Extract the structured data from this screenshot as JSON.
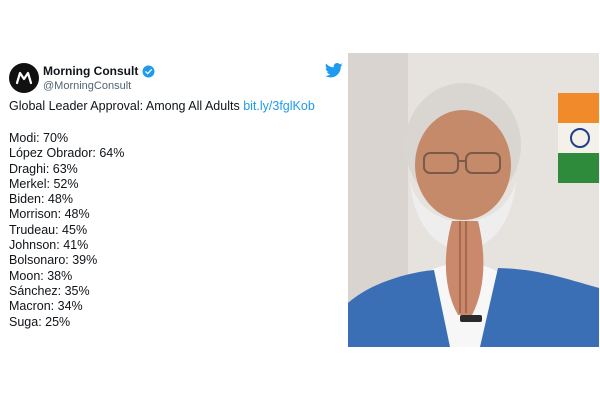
{
  "tweet": {
    "author": "Morning Consult",
    "handle": "@MorningConsult",
    "headline": "Global Leader Approval: Among All Adults",
    "link_text": "bit.ly/3fglKob",
    "list": [
      "Modi: 70%",
      "López Obrador: 64%",
      "Draghi: 63%",
      "Merkel: 52%",
      "Biden: 48%",
      "Morrison: 48%",
      "Trudeau: 45%",
      "Johnson: 41%",
      "Bolsonaro: 39%",
      "Moon: 38%",
      "Sánchez: 35%",
      "Macron: 34%",
      "Suga: 25%"
    ]
  },
  "icons": {
    "avatar": "morning-consult-logo-icon",
    "verified": "verified-badge-icon",
    "twitter": "twitter-bird-icon"
  },
  "colors": {
    "link": "#1d9bf0",
    "verified": "#1d9bf0",
    "text": "#0f1419",
    "muted": "#536471",
    "vest": "#3b6fb5"
  }
}
